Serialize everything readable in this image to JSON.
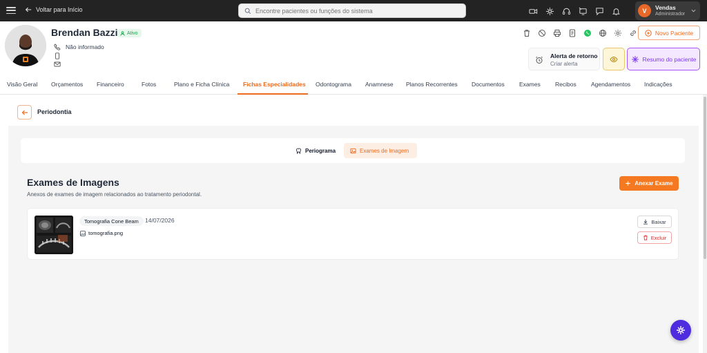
{
  "topbar": {
    "back_label": "Voltar para Início",
    "search_placeholder": "Encontre pacientes ou funções do sistema",
    "icons": [
      "video-icon",
      "sparkle-icon",
      "headset-icon",
      "screen-share-icon",
      "chat-icon",
      "bell-icon"
    ],
    "user": {
      "initial": "V",
      "name": "Vendas",
      "role": "Administrador"
    }
  },
  "patient": {
    "name": "Brendan Bazzi",
    "status": "Ativo",
    "phone": "Não informado",
    "mobile": "",
    "email": ""
  },
  "actions": {
    "icons": [
      "trash-icon",
      "block-icon",
      "print-icon",
      "document-icon",
      "whatsapp-icon",
      "globe-icon",
      "settings-icon",
      "link-icon"
    ],
    "new_patient": "Novo Paciente",
    "alert_title": "Alerta de retorno",
    "alert_sub": "Criar alerta",
    "summary": "Resumo do paciente"
  },
  "tabs": [
    "Visão Geral",
    "Orçamentos",
    "Financeiro",
    "Fotos",
    "Plano e Ficha Clínica",
    "Fichas Especialidades",
    "Odontograma",
    "Anamnese",
    "Planos Recorrentes",
    "Documentos",
    "Exames",
    "Recibos",
    "Agendamentos",
    "Indicações"
  ],
  "active_tab": "Fichas Especialidades",
  "section": {
    "title": "Periodontia"
  },
  "subtabs": {
    "periogram": "Periograma",
    "image_exams": "Exames de Imagem"
  },
  "exams": {
    "title": "Exames de Imagens",
    "description": "Anexos de exames de imagem relacionados ao tratamento periodontal.",
    "attach_label": "Anexar Exame",
    "items": [
      {
        "type": "Tomografia Cone Beam",
        "date": "14/07/2026",
        "file": "tomografia.png",
        "download": "Baixar",
        "delete": "Excluir"
      }
    ]
  },
  "colors": {
    "accent": "#ea6a1e",
    "topbar": "#232323",
    "active_status": "#16a34a",
    "summary_purple": "#7c3aed",
    "fab": "#4f2ddf"
  }
}
